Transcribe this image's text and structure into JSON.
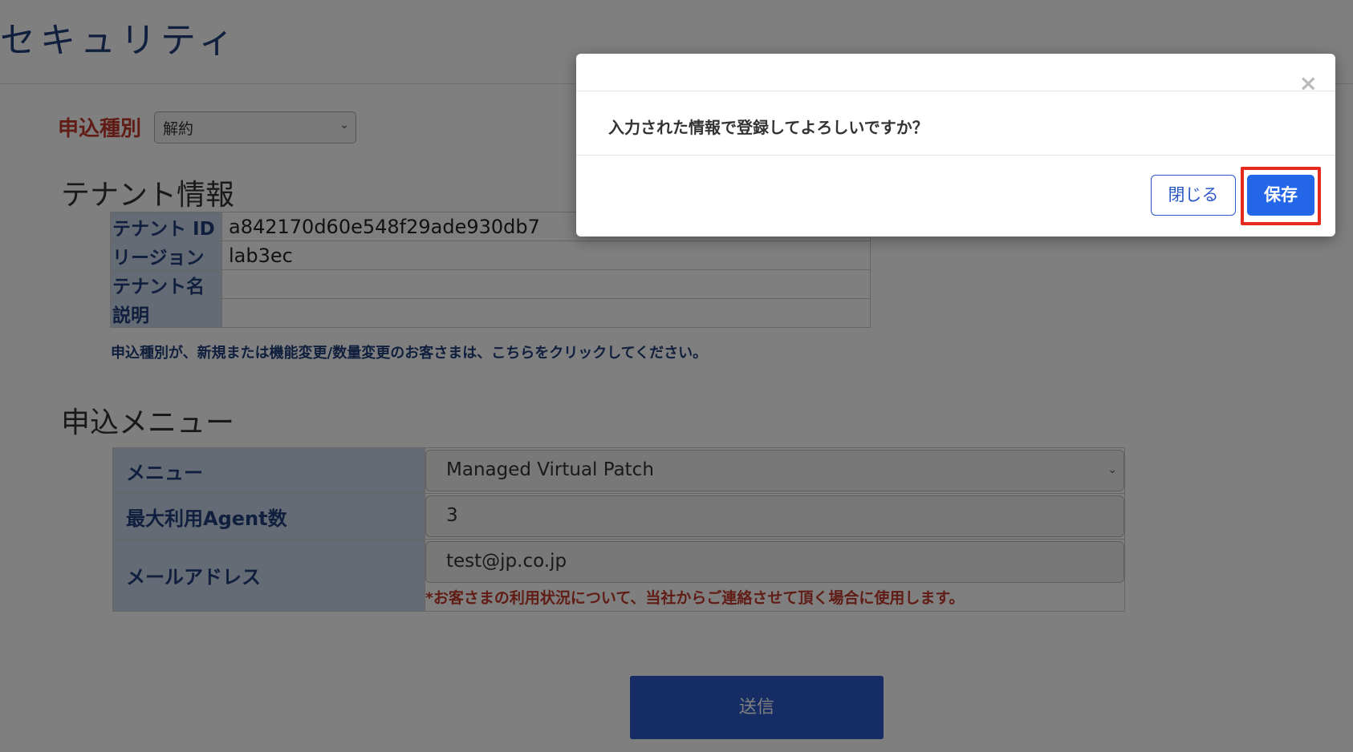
{
  "page": {
    "title": "セキュリティ"
  },
  "application_type": {
    "label": "申込種別",
    "selected": "解約"
  },
  "tenant_section": {
    "heading": "テナント情報",
    "rows": [
      {
        "key": "テナント ID",
        "value": "a842170d60e548f29ade930db7"
      },
      {
        "key": "リージョン",
        "value": "lab3ec"
      },
      {
        "key": "テナント名",
        "value": ""
      },
      {
        "key": "説明",
        "value": ""
      }
    ],
    "note": "申込種別が、新規または機能変更/数量変更のお客さまは、こちらをクリックしてください。"
  },
  "menu_section": {
    "heading": "申込メニュー",
    "menu_label": "メニュー",
    "menu_value": "Managed Virtual Patch",
    "agents_label": "最大利用Agent数",
    "agents_value": "3",
    "email_label": "メールアドレス",
    "email_value": "test@jp.co.jp",
    "email_note": "*お客さまの利用状況について、当社からご連絡させて頂く場合に使用します。"
  },
  "submit_label": "送信",
  "modal": {
    "close_icon": "×",
    "message": "入力された情報で登録してよろしいですか？",
    "close_button": "閉じる",
    "save_button": "保存"
  },
  "icons": {
    "chevron": "⌄"
  }
}
